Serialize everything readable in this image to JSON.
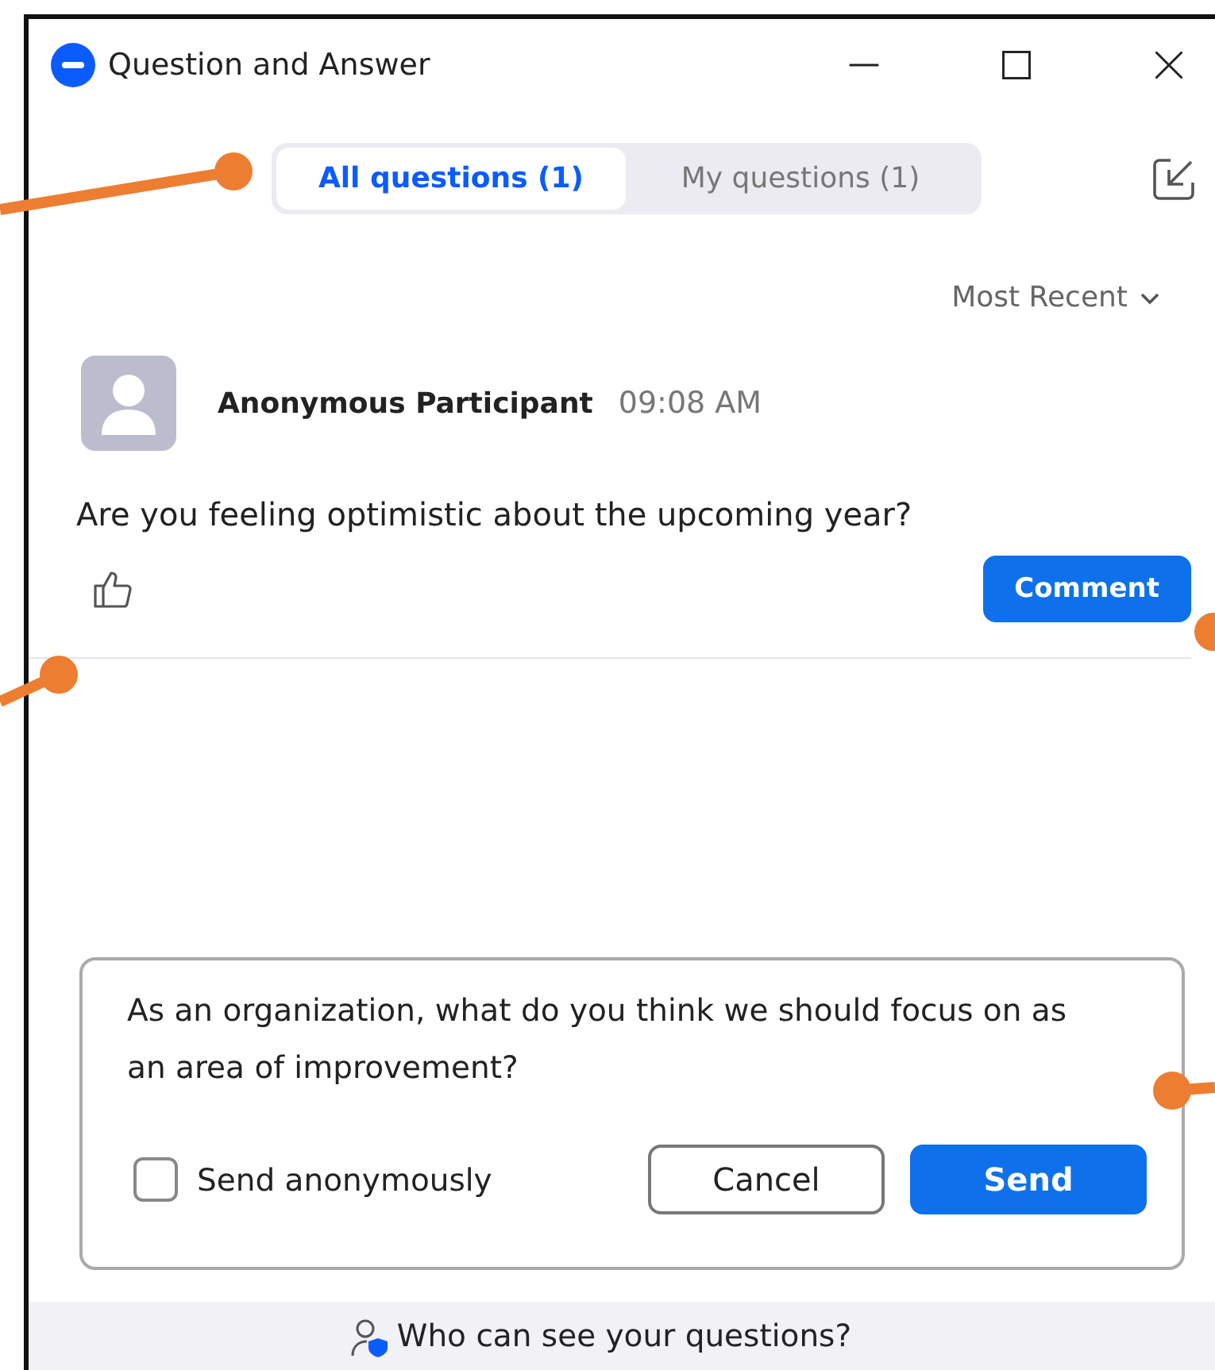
{
  "window": {
    "title": "Question and Answer"
  },
  "tabs": [
    {
      "label": "All questions (1)",
      "selected": true
    },
    {
      "label": "My questions (1)",
      "selected": false
    }
  ],
  "sort": {
    "label": "Most Recent"
  },
  "questions": [
    {
      "author": "Anonymous Participant",
      "time": "09:08 AM",
      "text": "Are you feeling optimistic about the upcoming year?",
      "action": "Comment"
    }
  ],
  "compose": {
    "value": "As an organization, what do you think we should focus on as an area of improvement?",
    "anonymous": {
      "label": "Send anonymously",
      "checked": false
    },
    "buttons": [
      {
        "label": "Cancel",
        "kind": "secondary"
      },
      {
        "label": "Send",
        "kind": "primary"
      }
    ]
  },
  "footer": {
    "link": "Who can see your questions?"
  }
}
